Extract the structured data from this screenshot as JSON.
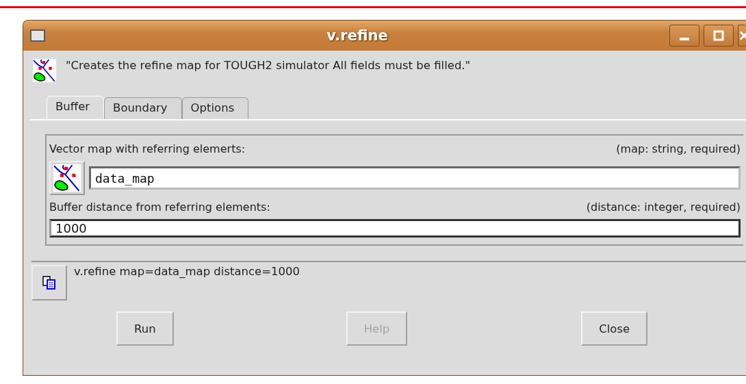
{
  "window": {
    "title": "v.refine"
  },
  "description": "\"Creates the refine map for TOUGH2 simulator  All fields must be filled.\"",
  "tabs": [
    {
      "label": "Buffer",
      "selected": true
    },
    {
      "label": "Boundary",
      "selected": false
    },
    {
      "label": "Options",
      "selected": false
    }
  ],
  "fields": [
    {
      "kind": "map",
      "label": "Vector map with referring elemerts:",
      "type_hint": "(map:  string, required)",
      "value": "data_map"
    },
    {
      "kind": "text",
      "label": "Buffer distance from referring elements:",
      "type_hint": "(distance:  integer, required)",
      "value": "1000"
    }
  ],
  "command": "v.refine map=data_map distance=1000",
  "buttons": [
    {
      "label": "Run",
      "disabled": false
    },
    {
      "label": "Help",
      "disabled": true
    },
    {
      "label": "Close",
      "disabled": false
    }
  ]
}
